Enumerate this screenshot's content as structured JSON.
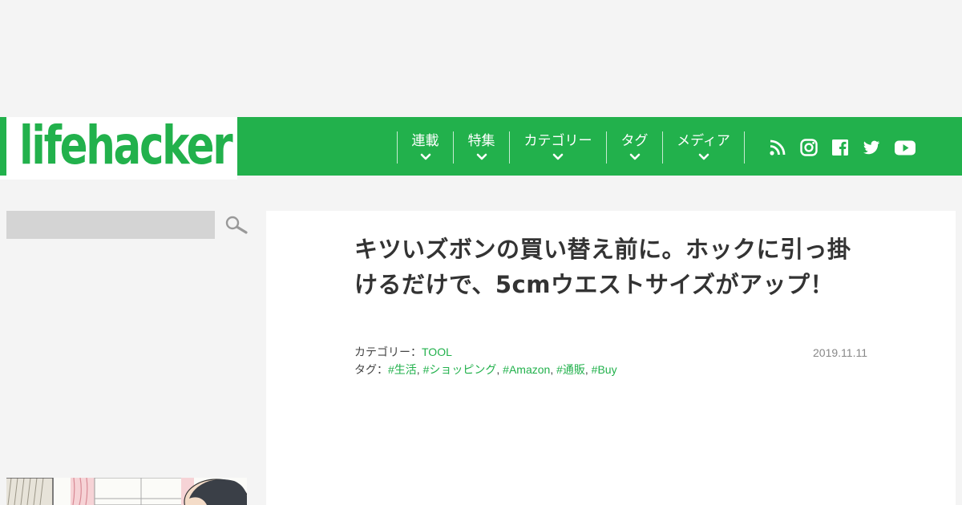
{
  "brand": {
    "logo_text": "lifehacker",
    "accent_color": "#22b14c"
  },
  "nav": {
    "items": [
      {
        "label": "連載"
      },
      {
        "label": "特集"
      },
      {
        "label": "カテゴリー"
      },
      {
        "label": "タグ"
      },
      {
        "label": "メディア"
      }
    ],
    "social_icons": [
      "rss-icon",
      "instagram-icon",
      "facebook-icon",
      "twitter-icon",
      "youtube-icon"
    ]
  },
  "search": {
    "value": "",
    "icon": "search-icon"
  },
  "article": {
    "title": "キツいズボンの買い替え前に。ホックに引っ掛けるだけで、5cmウエストサイズがアップ！",
    "category_label": "カテゴリー：",
    "category": "TOOL",
    "tags_label": "タグ：",
    "tags": [
      "#生活",
      "#ショッピング",
      "#Amazon",
      "#通販",
      "#Buy"
    ],
    "tag_separator": ", ",
    "date": "2019.11.11"
  }
}
